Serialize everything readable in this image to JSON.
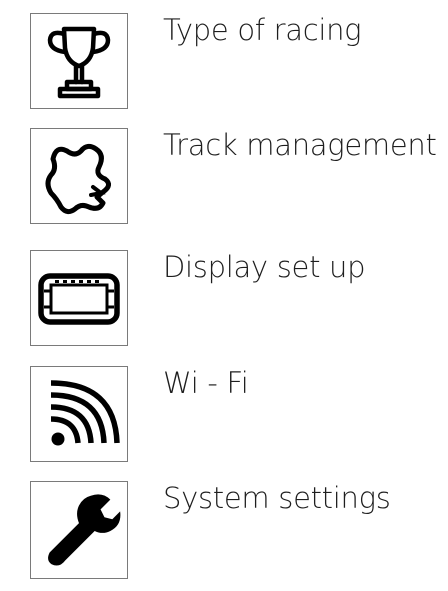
{
  "menu": {
    "items": [
      {
        "label": "Type of racing",
        "icon": "trophy-icon"
      },
      {
        "label": "Track management",
        "icon": "track-icon"
      },
      {
        "label": "Display set up",
        "icon": "display-icon"
      },
      {
        "label": "Wi - Fi",
        "icon": "wifi-icon"
      },
      {
        "label": "System settings",
        "icon": "wrench-icon"
      }
    ]
  },
  "colors": {
    "icon_stroke": "#000000",
    "box_border": "#7a7a7a",
    "text": "#1e1e1e",
    "background": "#ffffff"
  }
}
